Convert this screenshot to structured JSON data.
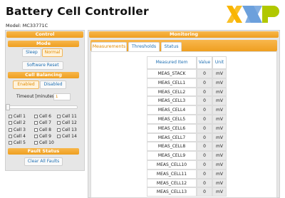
{
  "header": {
    "title": "Battery Cell Controller",
    "model": "Model: MC33771C",
    "logo_text": "NXP"
  },
  "control": {
    "panel_title": "Control",
    "mode_title": "Mode",
    "sleep_label": "Sleep",
    "normal_label": "Normal",
    "software_reset_label": "Software Reset",
    "balancing_title": "Cell Balancing",
    "enabled_label": "Enabled",
    "disabled_label": "Disabled",
    "timeout_label": "Timeout [minutes]:",
    "timeout_value": "1",
    "slider_level": 0,
    "cells": [
      [
        "Cell 1",
        "Cell 6",
        "Cell 11"
      ],
      [
        "Cell 2",
        "Cell 7",
        "Cell 12"
      ],
      [
        "Cell 3",
        "Cell 8",
        "Cell 13"
      ],
      [
        "Cell 4",
        "Cell 9",
        "Cell 14"
      ],
      [
        "Cell 5",
        "Cell 10",
        ""
      ]
    ],
    "fault_title": "Fault Status",
    "clear_faults_label": "Clear All Faults"
  },
  "monitoring": {
    "panel_title": "Monitoring",
    "tabs": [
      "Measurements",
      "Thresholds",
      "Status"
    ],
    "selected_tab": "Measurements",
    "columns": [
      "Measured Item",
      "Value",
      "Unit"
    ],
    "rows": [
      [
        "MEAS_STACK",
        "0",
        "mV"
      ],
      [
        "MEAS_CELL1",
        "0",
        "mV"
      ],
      [
        "MEAS_CELL2",
        "0",
        "mV"
      ],
      [
        "MEAS_CELL3",
        "0",
        "mV"
      ],
      [
        "MEAS_CELL4",
        "0",
        "mV"
      ],
      [
        "MEAS_CELL5",
        "0",
        "mV"
      ],
      [
        "MEAS_CELL6",
        "0",
        "mV"
      ],
      [
        "MEAS_CELL7",
        "0",
        "mV"
      ],
      [
        "MEAS_CELL8",
        "0",
        "mV"
      ],
      [
        "MEAS_CELL9",
        "0",
        "mV"
      ],
      [
        "MEAS_CELL10",
        "0",
        "mV"
      ],
      [
        "MEAS_CELL11",
        "0",
        "mV"
      ],
      [
        "MEAS_CELL12",
        "0",
        "mV"
      ],
      [
        "MEAS_CELL13",
        "0",
        "mV"
      ]
    ]
  },
  "colors": {
    "accent": "#ef9f20",
    "link": "#1f6fb2",
    "panel_bg": "#e6e6e6",
    "logo_yellow": "#f9b500",
    "logo_blue": "#6ca0dc",
    "logo_green": "#b1c800"
  }
}
